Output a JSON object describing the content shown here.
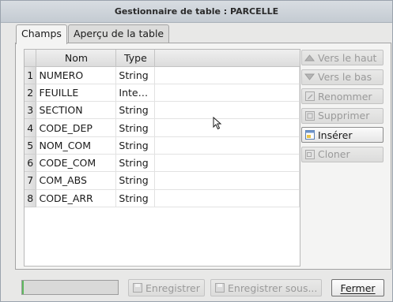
{
  "window": {
    "title": "Gestionnaire de table : PARCELLE"
  },
  "tabs": [
    {
      "label": "Champs",
      "active": true
    },
    {
      "label": "Aperçu de la table",
      "active": false
    }
  ],
  "table": {
    "headers": {
      "nom": "Nom",
      "type": "Type"
    },
    "rows": [
      {
        "num": "1",
        "nom": "NUMERO",
        "type": "String"
      },
      {
        "num": "2",
        "nom": "FEUILLE",
        "type": "Inte…"
      },
      {
        "num": "3",
        "nom": "SECTION",
        "type": "String"
      },
      {
        "num": "4",
        "nom": "CODE_DEP",
        "type": "String"
      },
      {
        "num": "5",
        "nom": "NOM_COM",
        "type": "String"
      },
      {
        "num": "6",
        "nom": "CODE_COM",
        "type": "String"
      },
      {
        "num": "7",
        "nom": "COM_ABS",
        "type": "String"
      },
      {
        "num": "8",
        "nom": "CODE_ARR",
        "type": "String"
      }
    ]
  },
  "side_buttons": {
    "up": {
      "label": "Vers le haut",
      "icon": "arrow-up-icon"
    },
    "down": {
      "label": "Vers le bas",
      "icon": "arrow-down-icon"
    },
    "rename": {
      "label": "Renommer",
      "icon": "rename-icon"
    },
    "delete": {
      "label": "Supprimer",
      "icon": "delete-icon"
    },
    "insert": {
      "label": "Insérer",
      "icon": "insert-icon"
    },
    "clone": {
      "label": "Cloner",
      "icon": "clone-icon"
    }
  },
  "footer": {
    "save": "Enregistrer",
    "save_as": "Enregistrer sous...",
    "close": "Fermer"
  },
  "colors": {
    "disabled_text": "#9a9a9a",
    "progress": "#5fb85f",
    "window_bg": "#e8e8e7"
  }
}
